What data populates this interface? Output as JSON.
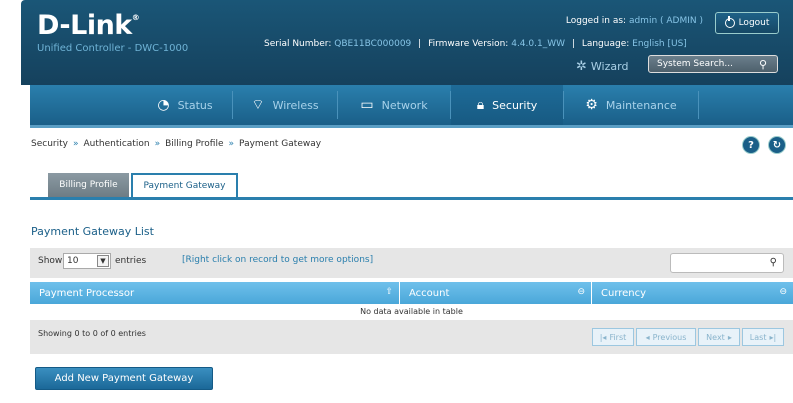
{
  "header": {
    "logo": "D-Link",
    "logo_reg": "®",
    "subtitle": "Unified Controller - DWC-1000",
    "logged_in_label": "Logged in as:",
    "logged_in_user": "admin ( ADMIN )",
    "logout_label": "Logout",
    "serial_label": "Serial Number:",
    "serial_value": "QBE11BC000009",
    "firmware_label": "Firmware Version:",
    "firmware_value": "4.4.0.1_WW",
    "language_label": "Language:",
    "language_value": "English [US]",
    "wizard_label": "Wizard",
    "search_placeholder": "System Search..."
  },
  "nav": {
    "items": [
      {
        "label": "Status",
        "icon": "gauge-icon"
      },
      {
        "label": "Wireless",
        "icon": "wifi-icon"
      },
      {
        "label": "Network",
        "icon": "monitor-icon"
      },
      {
        "label": "Security",
        "icon": "lock-icon",
        "active": true
      },
      {
        "label": "Maintenance",
        "icon": "gears-icon"
      }
    ]
  },
  "breadcrumb": {
    "items": [
      "Security",
      "Authentication",
      "Billing Profile",
      "Payment Gateway"
    ],
    "separator": "»"
  },
  "tabs": [
    {
      "label": "Billing Profile",
      "active": false
    },
    {
      "label": "Payment Gateway",
      "active": true
    }
  ],
  "section_title": "Payment Gateway List",
  "table": {
    "show_label": "Show",
    "entries_value": "10",
    "entries_label": "entries",
    "hint": "[Right click on record to get more options]",
    "columns": [
      "Payment Processor",
      "Account",
      "Currency"
    ],
    "empty_message": "No data available in table",
    "showing": "Showing 0 to 0 of 0 entries",
    "pagination": [
      "First",
      "Previous",
      "Next",
      "Last"
    ]
  },
  "add_button_label": "Add New Payment Gateway",
  "colors": {
    "header_bg": "#1a5677",
    "nav_bg": "#2a7fad",
    "table_header": "#4aa7d9",
    "accent": "#2a7fad"
  }
}
